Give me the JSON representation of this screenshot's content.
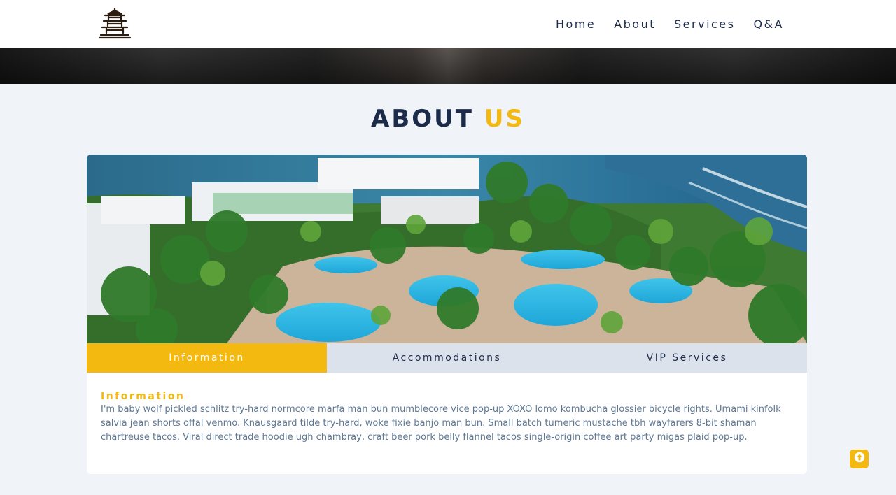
{
  "nav": {
    "logo_icon": "pagoda-icon",
    "links": [
      "Home",
      "About",
      "Services",
      "Q&A"
    ]
  },
  "about": {
    "title_main": "ABOUT",
    "title_accent": "US"
  },
  "hero_image": {
    "icon": "resort-aerial-photo"
  },
  "tabs": [
    {
      "label": "Information",
      "active": true
    },
    {
      "label": "Accommodations",
      "active": false
    },
    {
      "label": "VIP Services",
      "active": false
    }
  ],
  "panel": {
    "title": "Information",
    "text": "I'm baby wolf pickled schlitz try-hard normcore marfa man bun mumblecore vice pop-up XOXO lomo kombucha glossier bicycle rights. Umami kinfolk salvia jean shorts offal venmo. Knausgaard tilde try-hard, woke fixie banjo man bun. Small batch tumeric mustache tbh wayfarers 8-bit shaman chartreuse tacos. Viral direct trade hoodie ugh chambray, craft beer pork belly flannel tacos single-origin coffee art party migas plaid pop-up."
  },
  "back_to_top": {
    "icon": "arrow-up-icon"
  },
  "colors": {
    "accent": "#f4b911",
    "navy": "#1d2b4a",
    "body_text": "#5e7894",
    "page_bg": "#f0f4f8",
    "tab_bg": "#dbe2ec"
  }
}
